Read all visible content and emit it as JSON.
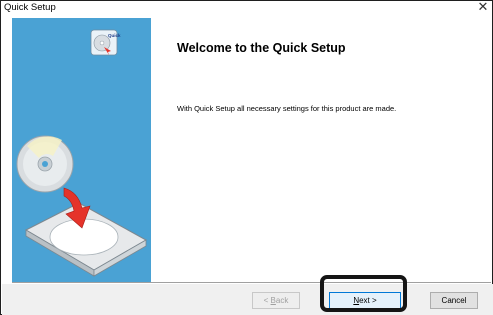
{
  "window": {
    "title": "Quick Setup",
    "close_glyph": "✕"
  },
  "left_panel": {
    "background": "#4aa2d4",
    "badge_text": "Quick",
    "icons": [
      "quick-setup-cd-icon",
      "cd-disc-icon",
      "cd-drive-tray-icon",
      "insert-arrow-icon"
    ]
  },
  "content": {
    "heading": "Welcome to the Quick Setup",
    "description": "With Quick Setup all necessary settings for this product are made."
  },
  "buttons": {
    "back": {
      "prefix": "< ",
      "mnemonic": "B",
      "rest": "ack",
      "enabled": false
    },
    "next": {
      "mnemonic": "N",
      "rest": "ext >"
    },
    "cancel": "Cancel"
  },
  "colors": {
    "accent": "#0078d7",
    "highlight_border": "#151515",
    "arrow": "#e5332a"
  }
}
